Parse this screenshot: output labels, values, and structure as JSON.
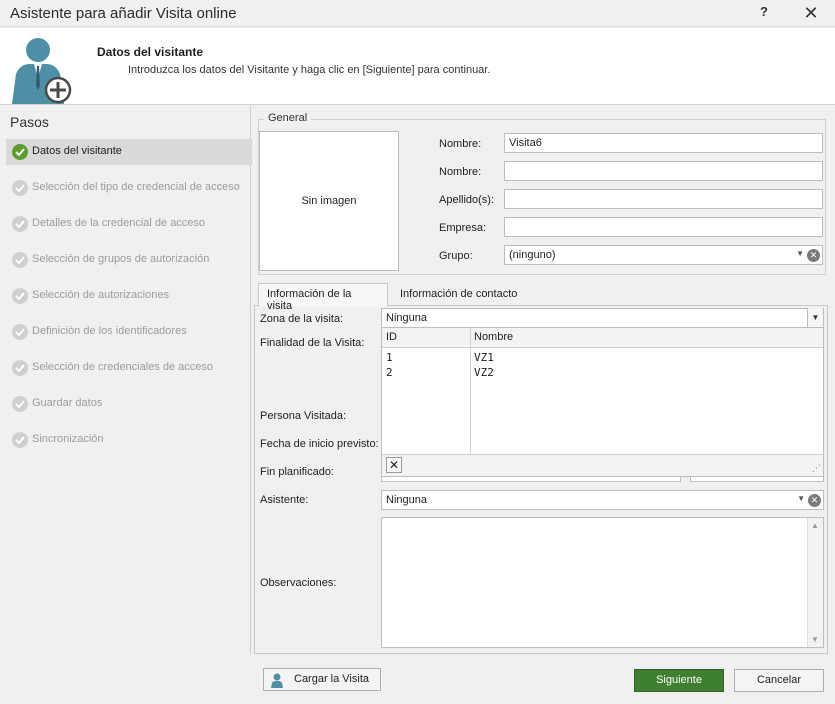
{
  "window": {
    "title": "Asistente para añadir Visita online",
    "help": "?",
    "close": "✕"
  },
  "header": {
    "title": "Datos del visitante",
    "subtitle": "Introduzca los datos del Visitante y haga clic en [Siguiente] para continuar."
  },
  "steps": {
    "title": "Pasos",
    "items": [
      {
        "label": "Datos del visitante",
        "active": true
      },
      {
        "label": "Selección del tipo de credencial de acceso"
      },
      {
        "label": "Detalles de la credencial de acceso"
      },
      {
        "label": "Selección de grupos de autorización"
      },
      {
        "label": "Selección de autorizaciones"
      },
      {
        "label": "Definición de los identificadores"
      },
      {
        "label": "Selección de credenciales de acceso"
      },
      {
        "label": "Guardar datos"
      },
      {
        "label": "Sincronización"
      }
    ]
  },
  "general": {
    "legend": "General",
    "photo_placeholder": "Sin imagen",
    "nombre1_label": "Nombre:",
    "nombre1_value": "Visita6",
    "nombre2_label": "Nombre:",
    "nombre2_value": "",
    "apellidos_label": "Apellido(s):",
    "apellidos_value": "",
    "empresa_label": "Empresa:",
    "empresa_value": "",
    "grupo_label": "Grupo:",
    "grupo_value": "(ninguno)"
  },
  "tabs": [
    {
      "label": "Información de la visita"
    },
    {
      "label": "Información de contacto"
    }
  ],
  "visit": {
    "zona_label": "Zona de la visita:",
    "zona_value": "Ninguna",
    "finalidad_label": "Finalidad de la Visita:",
    "persona_label": "Persona Visitada:",
    "fecha_inicio_label": "Fecha de inicio previsto:",
    "fin_label": "Fin planificado:",
    "asistente_label": "Asistente:",
    "asistente_value": "Ninguna",
    "observaciones_label": "Observaciones:"
  },
  "popup": {
    "columns": [
      "ID",
      "Nombre"
    ],
    "rows": [
      {
        "id": "1",
        "nombre": "VZ1"
      },
      {
        "id": "2",
        "nombre": "VZ2"
      }
    ]
  },
  "buttons": {
    "load": "Cargar la Visita",
    "next": "Siguiente",
    "cancel": "Cancelar"
  },
  "colors": {
    "accent_green": "#3f7f30",
    "check_green": "#5b9f2a",
    "avatar_teal": "#4e8fa6"
  }
}
